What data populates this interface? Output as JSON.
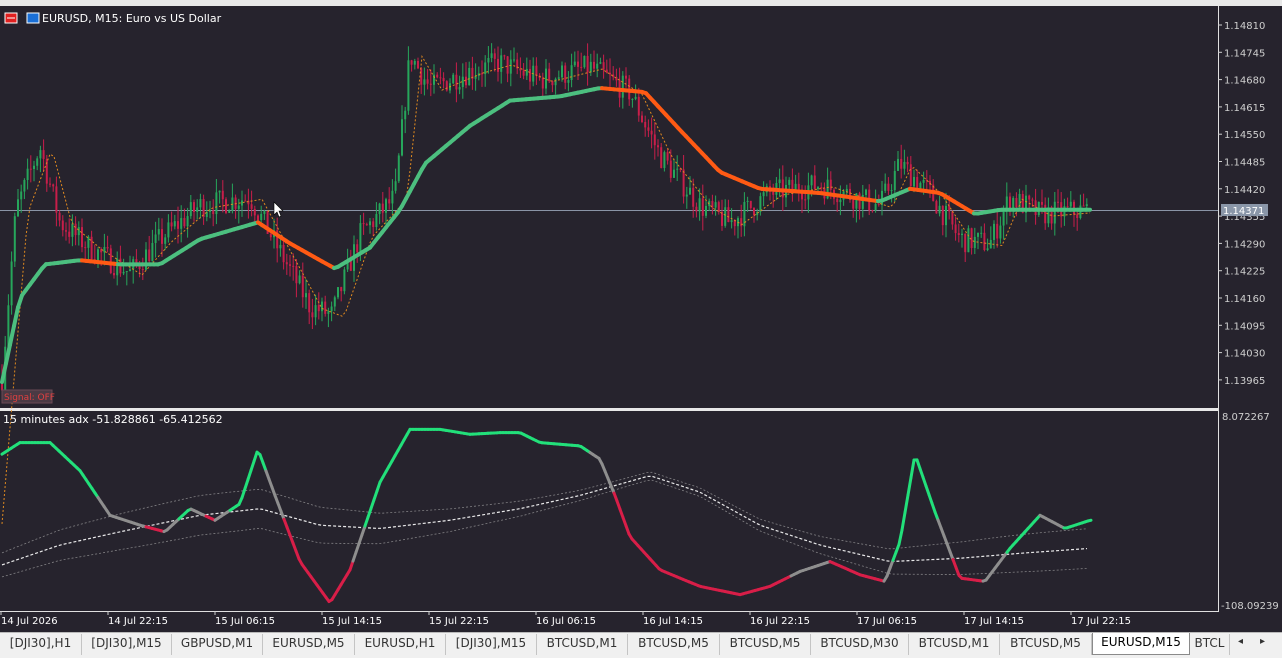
{
  "window": {
    "symbol_title": "EURUSD, M15:  Euro vs US Dollar",
    "signal_label": "Signal: OFF"
  },
  "price_axis": {
    "labels": [
      "1.14810",
      "1.14745",
      "1.14680",
      "1.14615",
      "1.14550",
      "1.14485",
      "1.14420",
      "1.14355",
      "1.14290",
      "1.14225",
      "1.14160",
      "1.14095",
      "1.14030",
      "1.13965"
    ],
    "current_price": "1.14371"
  },
  "indicator": {
    "label": "15 minutes adx  -51.828861 -65.412562",
    "scale_max": "8.072267",
    "scale_min": "-108.09239"
  },
  "time_axis": {
    "labels": [
      "14 Jul 2026",
      "14 Jul 22:15",
      "15 Jul 06:15",
      "15 Jul 14:15",
      "15 Jul 22:15",
      "16 Jul 06:15",
      "16 Jul 14:15",
      "16 Jul 22:15",
      "17 Jul 06:15",
      "17 Jul 14:15",
      "17 Jul 22:15"
    ]
  },
  "tabs": [
    {
      "label": "[DJI30],H1"
    },
    {
      "label": "[DJI30],M15"
    },
    {
      "label": "GBPUSD,M1"
    },
    {
      "label": "EURUSD,M5"
    },
    {
      "label": "EURUSD,H1"
    },
    {
      "label": "[DJI30],M15"
    },
    {
      "label": "BTCUSD,M1"
    },
    {
      "label": "BTCUSD,M5"
    },
    {
      "label": "BTCUSD,M5"
    },
    {
      "label": "BTCUSD,M30"
    },
    {
      "label": "BTCUSD,M1"
    },
    {
      "label": "BTCUSD,M5"
    },
    {
      "label": "EURUSD,M15",
      "active": true
    },
    {
      "label": "BTCL"
    }
  ],
  "tab_scroll": {
    "left": "◂",
    "right": "▸"
  },
  "colors": {
    "background": "#26232d",
    "bull_candle": "#26a65b",
    "bear_candle": "#c81e4a",
    "ma_up": "#4cbf7f",
    "ma_down": "#ff5a14",
    "adx_up": "#22e07a",
    "adx_down": "#d81e48",
    "adx_neutral": "#8e8e8e",
    "band": "#aaaaaa"
  },
  "chart_data": {
    "type": "candlestick",
    "symbol": "EURUSD",
    "timeframe": "M15",
    "x": [
      "14 Jul 2026",
      "14 Jul 22:15",
      "15 Jul 06:15",
      "15 Jul 14:15",
      "15 Jul 22:15",
      "16 Jul 06:15",
      "16 Jul 14:15",
      "16 Jul 22:15",
      "17 Jul 06:15",
      "17 Jul 14:15",
      "17 Jul 22:15"
    ],
    "close_trend": [
      1.1397,
      1.1424,
      1.144,
      1.142,
      1.1466,
      1.1467,
      1.1466,
      1.1442,
      1.1448,
      1.1433,
      1.1438
    ],
    "ma_slow": [
      1.1396,
      1.1423,
      1.1423,
      1.143,
      1.1458,
      1.1463,
      1.1463,
      1.1446,
      1.1443,
      1.1437,
      1.1437
    ],
    "ylim": [
      1.1393,
      1.1483
    ],
    "last_price": 1.14371,
    "indicator": {
      "name": "15 minutes adx",
      "values": [
        -51.828861,
        -65.412562
      ],
      "ylim": [
        -108.09239,
        8.072267
      ],
      "adx": [
        0,
        -10,
        -25,
        -100,
        -5,
        -15,
        -50,
        -90,
        -60,
        -20,
        -35,
        -55
      ],
      "mid": [
        -82,
        -62,
        -48,
        -56,
        -48,
        -40,
        -18,
        -35,
        -70,
        -75,
        -70,
        -66
      ]
    }
  }
}
